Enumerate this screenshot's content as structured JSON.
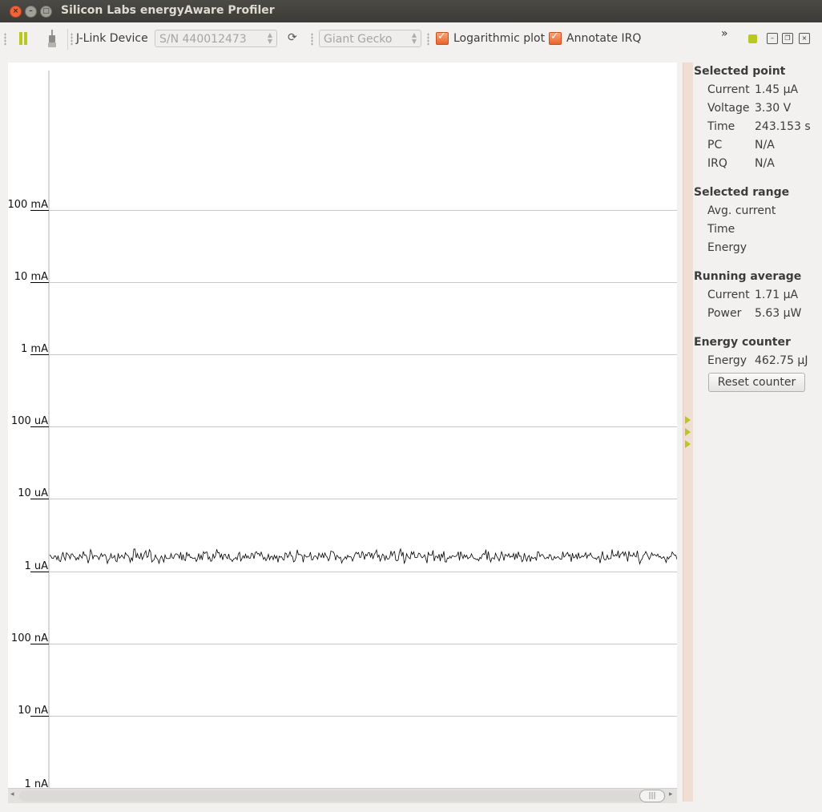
{
  "window": {
    "title": "Silicon Labs energyAware Profiler"
  },
  "toolbar": {
    "device_label": "J-Link Device",
    "serial_value": "S/N 440012473",
    "target_value": "Giant Gecko",
    "log_plot_label": "Logarithmic plot",
    "log_plot_checked": true,
    "annotate_irq_label": "Annotate IRQ",
    "annotate_irq_checked": true,
    "overflow_glyph": "»",
    "refresh_glyph": "⟳"
  },
  "panel": {
    "selected_point": {
      "title": "Selected point",
      "rows": [
        {
          "label": "Current",
          "value": "1.45 µA"
        },
        {
          "label": "Voltage",
          "value": "3.30 V"
        },
        {
          "label": "Time",
          "value": "243.153 s"
        },
        {
          "label": "PC",
          "value": "N/A"
        },
        {
          "label": "IRQ",
          "value": "N/A"
        }
      ]
    },
    "selected_range": {
      "title": "Selected range",
      "rows": [
        {
          "label": "Avg. current",
          "value": ""
        },
        {
          "label": "Time",
          "value": ""
        },
        {
          "label": "Energy",
          "value": ""
        }
      ]
    },
    "running_average": {
      "title": "Running average",
      "rows": [
        {
          "label": "Current",
          "value": "1.71 µA"
        },
        {
          "label": "Power",
          "value": "5.63 µW"
        }
      ]
    },
    "energy_counter": {
      "title": "Energy counter",
      "rows": [
        {
          "label": "Energy",
          "value": "462.75 µJ"
        }
      ],
      "reset_label": "Reset counter"
    }
  },
  "chart_data": {
    "type": "line",
    "y_scale": "log",
    "y_unit": "A",
    "y_ticks": [
      "100 mA",
      "10 mA",
      "1 mA",
      "100 uA",
      "10 uA",
      "1 uA",
      "100 nA",
      "10 nA",
      "1 nA"
    ],
    "ylim_amps": [
      1e-09,
      0.1
    ],
    "grid": true,
    "series": [
      {
        "trace_mean_amps": 1.6e-06,
        "trace_noise_decades": 0.05,
        "color": "#000000"
      }
    ]
  },
  "colors": {
    "accent": "#b8c81e",
    "checkbox": "#e9652b",
    "titlebar": "#3c3b37",
    "divider": "#f0ddd4"
  }
}
